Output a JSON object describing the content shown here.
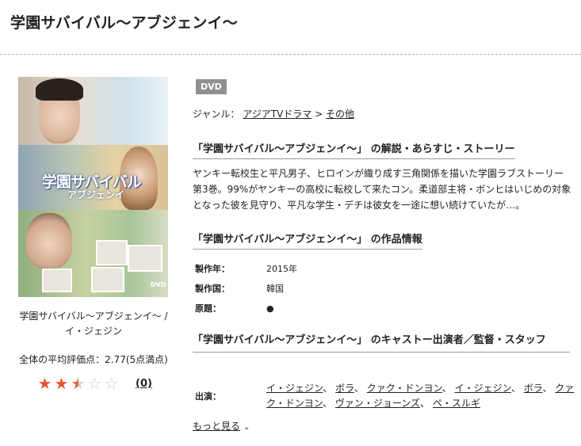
{
  "page": {
    "title": "学園サバイバル〜アブジェンイ〜"
  },
  "poster": {
    "logo_main": "学園サバイバル",
    "logo_sub": "アブジェンイ",
    "dvd_mark": "DVD",
    "caption": "学園サバイバル〜アブジェンイ〜 / イ・ジェジン",
    "rating_text": "全体の平均評価点：2.77(5点満点)",
    "rating_value": 2.77,
    "rating_max": 5,
    "review_count": "(0)"
  },
  "badge": "DVD",
  "genre": {
    "label": "ジャンル：",
    "items": [
      "アジアTVドラマ",
      "その他"
    ],
    "separator": ">"
  },
  "sections": {
    "story_title": "「学園サバイバル〜アブジェンイ〜」 の解説・あらすじ・ストーリー",
    "story_text": "ヤンキー転校生と平凡男子、ヒロインが織り成す三角関係を描いた学園ラブストーリー第3巻。99%がヤンキーの高校に転校して来たコン。柔道部主将・ボンヒはいじめの対象となった彼を見守り、平凡な学生・デチは彼女を一途に想い続けていたが…。",
    "info_title": "「学園サバイバル〜アブジェンイ〜」 の作品情報",
    "info": [
      {
        "label": "製作年：",
        "value": "2015年"
      },
      {
        "label": "製作国：",
        "value": "韓国"
      },
      {
        "label": "原題：",
        "value": "●"
      }
    ],
    "cast_title": "「学園サバイバル〜アブジェンイ〜」 のキャストー出演者／監督・スタッフ",
    "cast_label": "出演：",
    "cast": [
      "イ・ジェジン",
      "ボラ",
      "クァク・ドンヨン",
      "イ・ジェジン",
      "ボラ",
      "クァク・ドンヨン",
      "ヴァン・ジョーンズ",
      "ペ・スルギ"
    ],
    "more": "もっと見る"
  }
}
